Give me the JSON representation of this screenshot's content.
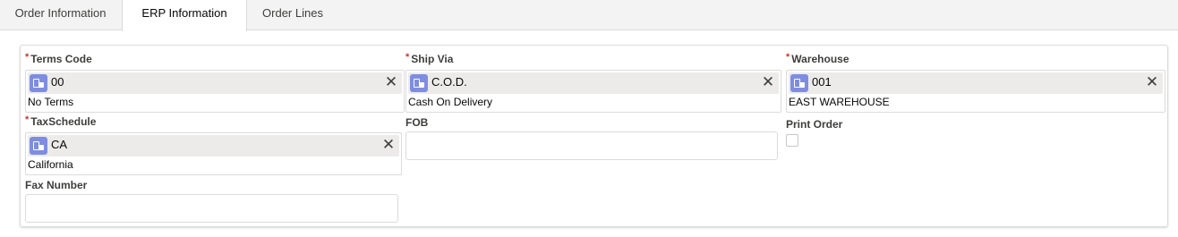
{
  "tabs": [
    {
      "label": "Order Information",
      "active": false
    },
    {
      "label": "ERP Information",
      "active": true
    },
    {
      "label": "Order Lines",
      "active": false
    }
  ],
  "fields": {
    "terms_code": {
      "label": "Terms Code",
      "required": true,
      "value": "00",
      "description": "No Terms"
    },
    "ship_via": {
      "label": "Ship Via",
      "required": true,
      "value": "C.O.D.",
      "description": "Cash On Delivery"
    },
    "warehouse": {
      "label": "Warehouse",
      "required": true,
      "value": "001",
      "description": "EAST WAREHOUSE"
    },
    "tax_schedule": {
      "label": "TaxSchedule",
      "required": true,
      "value": "CA",
      "description": "California"
    },
    "fob": {
      "label": "FOB",
      "required": false,
      "value": ""
    },
    "print_order": {
      "label": "Print Order",
      "checked": false
    },
    "fax_number": {
      "label": "Fax Number",
      "required": false,
      "value": ""
    }
  },
  "symbols": {
    "required_mark": "*",
    "clear": "✕"
  },
  "icons": {
    "lookup": "record-lookup-icon",
    "clear": "close-icon"
  },
  "colors": {
    "required": "#c23934",
    "lookup_icon_bg": "#7f8de1",
    "pill_bg": "#ecebea"
  }
}
